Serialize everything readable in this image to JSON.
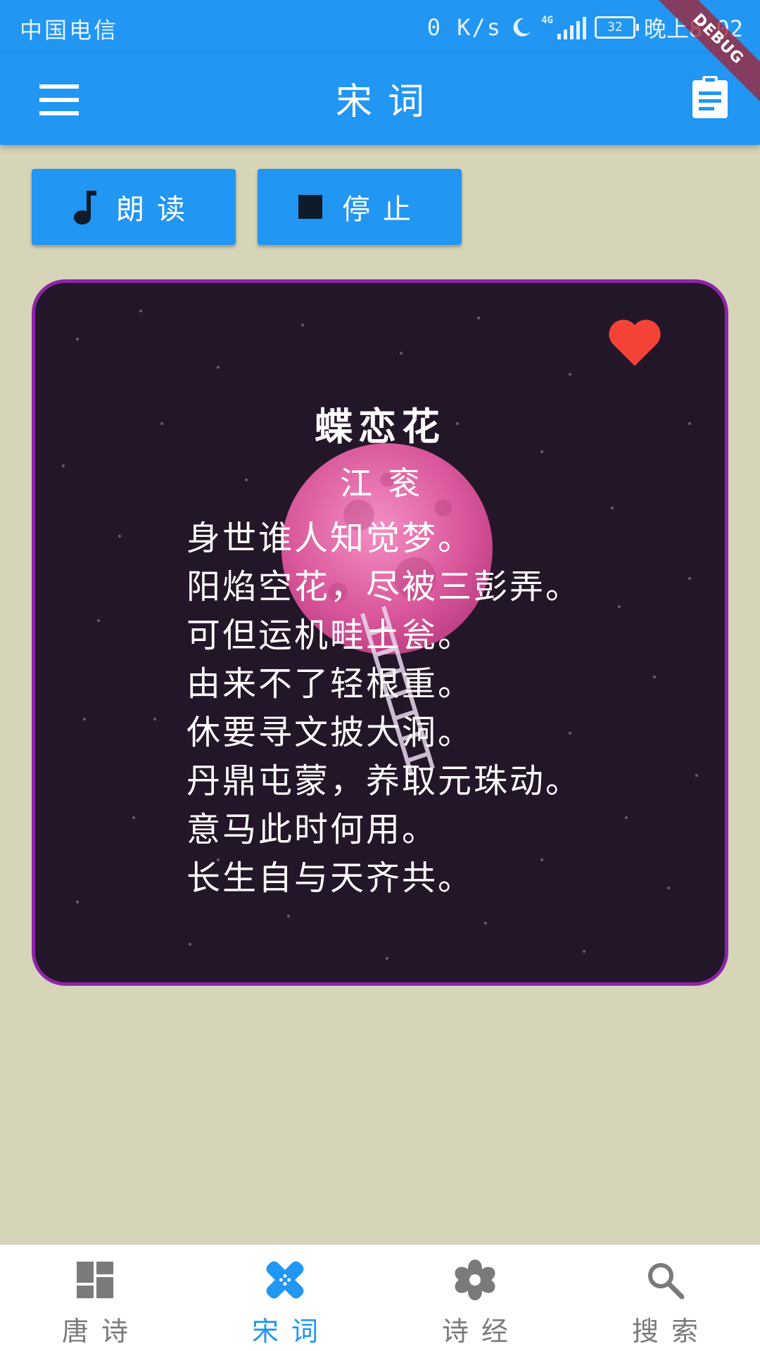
{
  "status_bar": {
    "carrier": "中国电信",
    "speed": "0 K/s",
    "network": "4G",
    "battery": "32",
    "time": "晚上8:02",
    "icons": [
      "moon-icon",
      "signal-icon",
      "battery-icon"
    ]
  },
  "app_bar": {
    "title": "宋词",
    "menu_icon": "hamburger-menu-icon",
    "action_icon": "clipboard-icon"
  },
  "debug_banner": "DEBUG",
  "actions": {
    "read_label": "朗读",
    "stop_label": "停止"
  },
  "poem": {
    "title": "蝶恋花",
    "author": "江衮",
    "lines": [
      "身世谁人知觉梦。",
      "阳焰空花，尽被三彭弄。",
      "可但运机畦土瓮。",
      "由来不了轻根重。",
      "休要寻文披大洞。",
      "丹鼎屯蒙，养取元珠动。",
      "意马此时何用。",
      "长生自与天齐共。"
    ],
    "favorited": true
  },
  "bottom_nav": {
    "items": [
      {
        "label": "唐诗",
        "icon": "dashboard-icon",
        "active": false
      },
      {
        "label": "宋词",
        "icon": "healing-icon",
        "active": true
      },
      {
        "label": "诗经",
        "icon": "flower-icon",
        "active": false
      },
      {
        "label": "搜索",
        "icon": "search-icon",
        "active": false
      }
    ]
  },
  "colors": {
    "primary": "#2196f3",
    "page_background": "#d6d5b8",
    "card_border": "#8e24aa",
    "card_background": "#241629",
    "favorite": "#f44336",
    "nav_inactive": "#7a7a7a"
  }
}
